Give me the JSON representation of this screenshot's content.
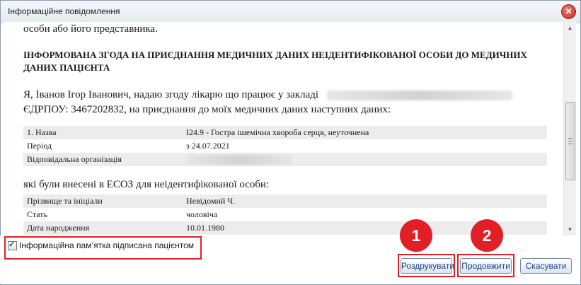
{
  "window": {
    "title": "Інформаційне повідомлення",
    "close_glyph": "✕"
  },
  "content": {
    "para_top": "особи або його представника.",
    "heading": "ІНФОРМОВАНА ЗГОДА НА ПРИЄДНАННЯ МЕДИЧНИХ ДАНИХ НЕІДЕНТИФІКОВАНОЇ ОСОБИ ДО МЕДИЧНИХ ДАНИХ ПАЦІЄНТА",
    "consent_line1": "Я, Іванов Ігор Іванович, надаю згоду лікарю що працює у закладі",
    "consent_line2": "ЄДРПОУ: 3467202832, на приєднання до моїх медичних даних наступних даних:",
    "table1": [
      {
        "key": "1. Назва",
        "value": "I24.9 - Гостра ішемічна хвороба серця, неуточнена"
      },
      {
        "key": "Період",
        "value": "з 24.07.2021"
      },
      {
        "key": "Відповідальна організація",
        "value": ""
      }
    ],
    "section2": "які були внесені в ЕСОЗ для неідентифікованої особи:",
    "table2": [
      {
        "key": "Прізвище та ініціали",
        "value": "Невідомий Ч."
      },
      {
        "key": "Стать",
        "value": "чоловіча"
      },
      {
        "key": "Дата народження",
        "value": "10.01.1980"
      }
    ]
  },
  "footer": {
    "checkbox_label": "Інформаційна пам’ятка підписана пацієнтом",
    "checkbox_checked": true,
    "buttons": {
      "print": "Роздрукувати",
      "continue": "Продовжити",
      "cancel": "Скасувати"
    },
    "badges": {
      "one": "1",
      "two": "2"
    }
  },
  "colors": {
    "accent_red": "#e21f26",
    "button_text": "#15428b"
  },
  "icons": {
    "close": "close-icon",
    "scroll_up": "scroll-up-arrow-icon",
    "scroll_down": "scroll-down-arrow-icon"
  }
}
